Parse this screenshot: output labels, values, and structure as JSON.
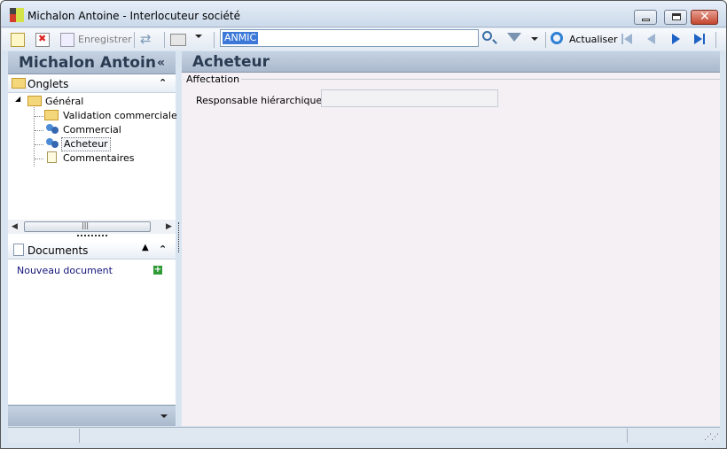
{
  "window": {
    "title_name": "Michalon Antoine",
    "title_sep": " - ",
    "title_context": "Interlocuteur société",
    "close_glyph": "✕"
  },
  "toolbar": {
    "save_label": "Enregistrer",
    "search_value": "ANMIC",
    "refresh_label": "Actualiser"
  },
  "left_panel": {
    "header_name": "Michalon Antoin",
    "collapse_glyph": "«",
    "tabs_section_label": "Onglets",
    "tree": {
      "root": "Général",
      "children": [
        "Validation commerciale / B/",
        "Commercial",
        "Acheteur",
        "Commentaires"
      ]
    },
    "scroll_grip": "|||",
    "documents_label": "Documents",
    "new_document_label": "Nouveau document"
  },
  "main_panel": {
    "title": "Acheteur",
    "group_label": "Affectation",
    "field_label": "Responsable hiérarchique :",
    "field_value": ""
  },
  "colors": {
    "header_bg": "#aab9cd",
    "header_text": "#2b3b52",
    "link_color": "#14147a",
    "selection_blue": "#3c78d8"
  }
}
